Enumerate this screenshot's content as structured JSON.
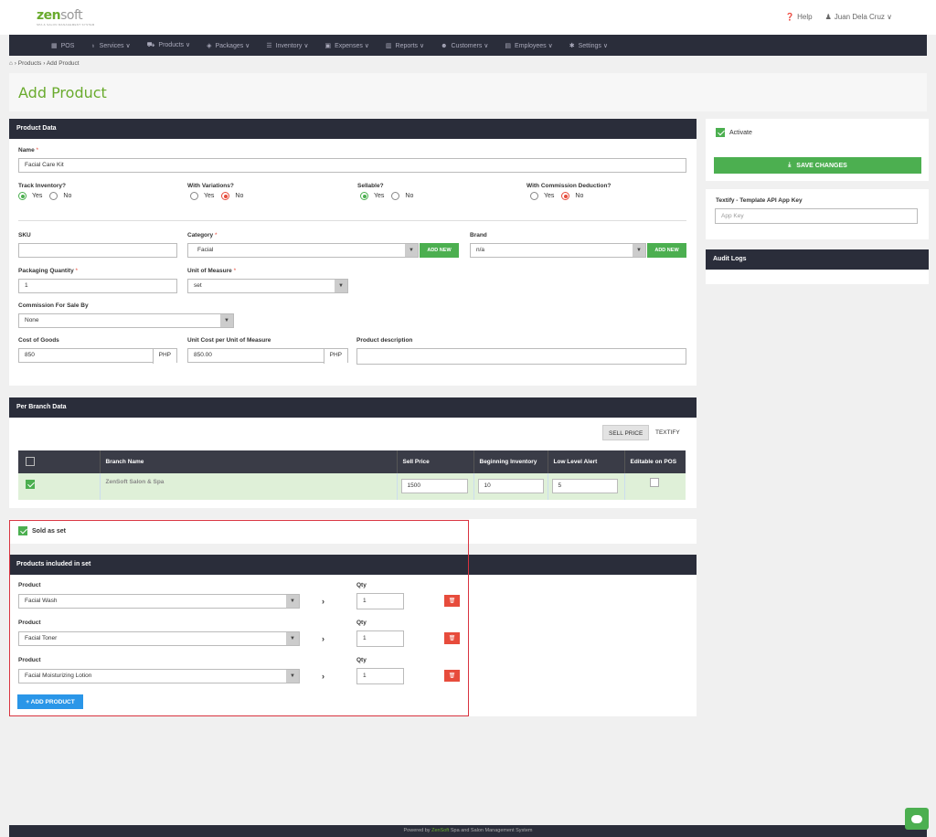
{
  "brand": {
    "logo_main": "zen",
    "logo_soft": "soft",
    "tagline": "SPA & SALON MANAGEMENT SYSTEM"
  },
  "top": {
    "help": "Help",
    "user": "Juan Dela Cruz"
  },
  "nav": [
    {
      "icon": "pos-icon",
      "glyph": "▦",
      "label": "POS"
    },
    {
      "icon": "services-icon",
      "glyph": "♁",
      "label": "Services ∨"
    },
    {
      "icon": "products-icon",
      "glyph": "⛟",
      "label": "Products ∨"
    },
    {
      "icon": "packages-icon",
      "glyph": "◈",
      "label": "Packages ∨"
    },
    {
      "icon": "inventory-icon",
      "glyph": "☰",
      "label": "Inventory ∨"
    },
    {
      "icon": "expenses-icon",
      "glyph": "▣",
      "label": "Expenses ∨"
    },
    {
      "icon": "reports-icon",
      "glyph": "▥",
      "label": "Reports ∨"
    },
    {
      "icon": "customers-icon",
      "glyph": "☻",
      "label": "Customers ∨"
    },
    {
      "icon": "employees-icon",
      "glyph": "▤",
      "label": "Employees ∨"
    },
    {
      "icon": "settings-icon",
      "glyph": "✱",
      "label": "Settings ∨"
    }
  ],
  "breadcrumb": {
    "home_glyph": "⌂",
    "sep": "›",
    "items": [
      "Products",
      "Add Product"
    ]
  },
  "page_title": "Add Product",
  "product_data": {
    "header": "Product Data",
    "name_label": "Name",
    "name_value": "Facial Care Kit",
    "track_label": "Track Inventory?",
    "variations_label": "With Variations?",
    "sellable_label": "Sellable?",
    "commission_deduction_label": "With Commission Deduction?",
    "yes": "Yes",
    "no": "No",
    "sku_label": "SKU",
    "category_label": "Category",
    "category_value": "Facial",
    "brand_label": "Brand",
    "brand_value": "n/a",
    "add_new": "ADD NEW",
    "packaging_label": "Packaging Quantity",
    "packaging_value": "1",
    "uom_label": "Unit of Measure",
    "uom_value": "set",
    "commission_label": "Commission For Sale By",
    "commission_value": "None",
    "cog_label": "Cost of Goods",
    "cog_value": "850",
    "currency": "PHP",
    "unit_cost_label": "Unit Cost per Unit of Measure",
    "unit_cost_value": "850.00",
    "desc_label": "Product description"
  },
  "right": {
    "activate": "Activate",
    "save": "SAVE CHANGES",
    "textify_label": "Textify - Template API App Key",
    "app_key_placeholder": "App Key",
    "audit": "Audit Logs"
  },
  "branch": {
    "header": "Per Branch Data",
    "tab_sell": "SELL PRICE",
    "tab_textify": "TEXTIFY",
    "columns": [
      "Branch Name",
      "Sell Price",
      "Beginning Inventory",
      "Low Level Alert",
      "Editable on POS"
    ],
    "row": {
      "name": "ZenSoft Salon & Spa",
      "sell_price": "1500",
      "beginning": "10",
      "low_alert": "5"
    }
  },
  "set": {
    "sold_as_set": "Sold as set",
    "header": "Products included in set",
    "product_label": "Product",
    "qty_label": "Qty",
    "items": [
      {
        "product": "Facial Wash",
        "qty": "1"
      },
      {
        "product": "Facial Toner",
        "qty": "1"
      },
      {
        "product": "Facial Moisturizing Lotion",
        "qty": "1"
      }
    ],
    "add_product": "+ ADD PRODUCT"
  },
  "footer": {
    "pre": "Powered by",
    "brand": "ZenSoft",
    "post": "Spa and Salon Management System"
  },
  "colors": {
    "accent": "#6aab2e",
    "nav_bg": "#2a2d3a",
    "green": "#4caf50",
    "red": "#e74c3c",
    "blue": "#2a96e8"
  }
}
